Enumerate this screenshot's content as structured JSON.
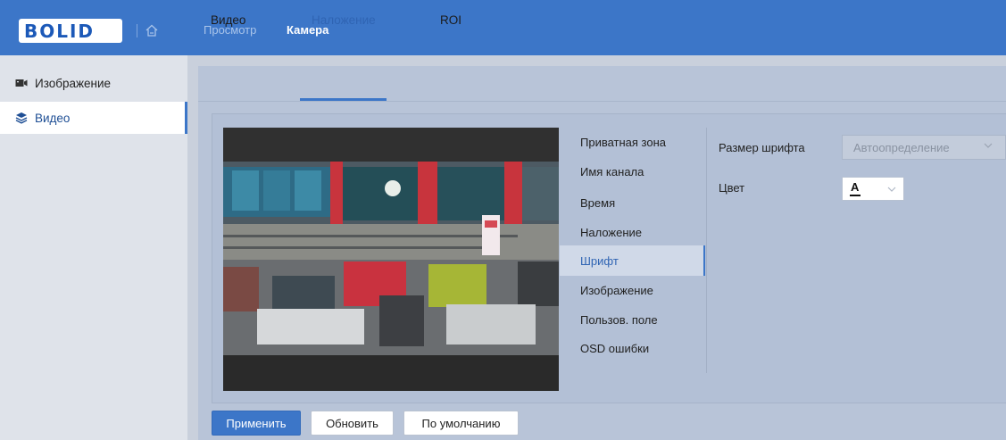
{
  "header": {
    "logo_text": "BOLID",
    "nav": [
      "Просмотр",
      "Камера"
    ],
    "active_nav": "Камера",
    "home_icon": "home-icon",
    "colors": {
      "bar": "#3c76c8",
      "nav_active": "#ffffff",
      "nav_inactive": "#a9c4ea"
    }
  },
  "sidebar": {
    "items": [
      {
        "label": "Изображение",
        "icon": "camera-icon"
      },
      {
        "label": "Видео",
        "icon": "layers-icon"
      }
    ],
    "active": "Видео"
  },
  "tabs": {
    "items": [
      "Видео",
      "Наложение",
      "ROI"
    ],
    "active": "Наложение"
  },
  "overlay_menu": {
    "items": [
      "Приватная зона",
      "Имя канала",
      "Время",
      "Наложение",
      "Шрифт",
      "Изображение",
      "Пользов. поле",
      "OSD ошибки"
    ],
    "active": "Шрифт"
  },
  "font_settings": {
    "size_label": "Размер шрифта",
    "size_value": "Автоопределение",
    "color_label": "Цвет",
    "color_value": "A",
    "color_swatch": "#111111"
  },
  "buttons": {
    "apply": "Применить",
    "refresh": "Обновить",
    "default": "По умолчанию"
  }
}
